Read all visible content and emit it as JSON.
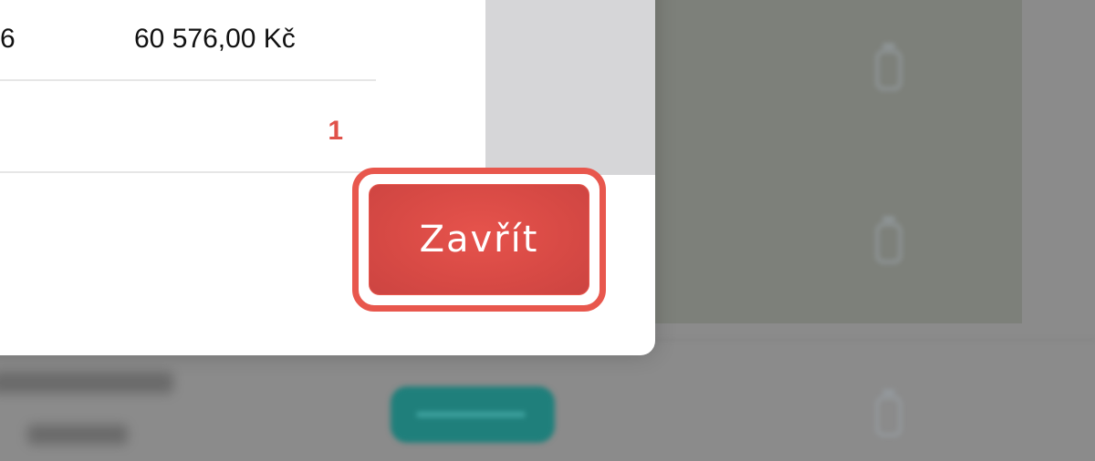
{
  "modal": {
    "row1": {
      "partial_value": "6",
      "amount": "60 576,00 Kč"
    },
    "row2": {
      "count": "1"
    },
    "close_button_label": "Zavřít"
  },
  "colors": {
    "accent_red": "#e0524a",
    "button_red": "#d84a45",
    "background_status_teal": "#1f7f7b"
  },
  "icons": {
    "background_row_action": "trash-icon"
  }
}
